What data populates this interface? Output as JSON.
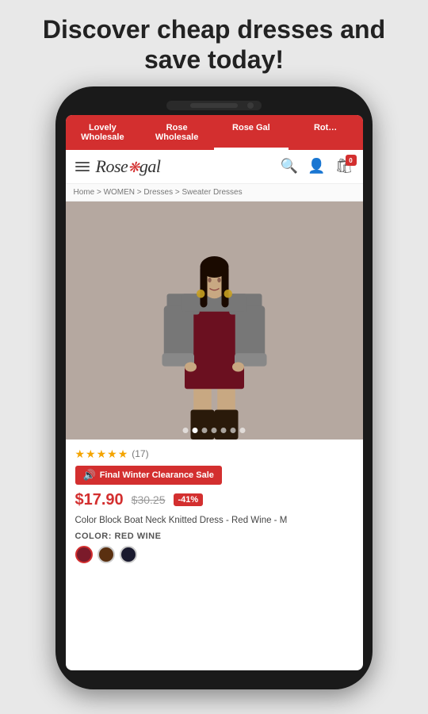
{
  "headline": "Discover cheap dresses and save today!",
  "phone": {
    "nav_tabs": [
      {
        "label": "Lovely\nWholesale",
        "active": false
      },
      {
        "label": "Rose\nWholesale",
        "active": false
      },
      {
        "label": "Rose Gal",
        "active": true
      },
      {
        "label": "Rot…",
        "active": false
      }
    ],
    "header": {
      "logo": "Rose●gal",
      "logo_main": "Rosegal",
      "search_label": "search",
      "account_label": "account",
      "cart_label": "cart",
      "cart_count": "0"
    },
    "breadcrumb": "Home > WOMEN > Dresses > Sweater Dresses",
    "product": {
      "image_alt": "Color Block Boat Neck Knitted Dress - Red Wine",
      "dots_count": 7,
      "active_dot": 1,
      "stars": "★★★★★",
      "review_count": "(17)",
      "sale_badge": "Final Winter Clearance Sale",
      "price_current": "$17.90",
      "price_original": "$30.25",
      "discount": "-41%",
      "title": "Color Block Boat Neck Knitted Dress - Red Wine - M",
      "color_label": "COLOR: RED WINE",
      "colors": [
        "#7b1a2a",
        "#5a3010",
        "#1a1a2e"
      ]
    }
  }
}
